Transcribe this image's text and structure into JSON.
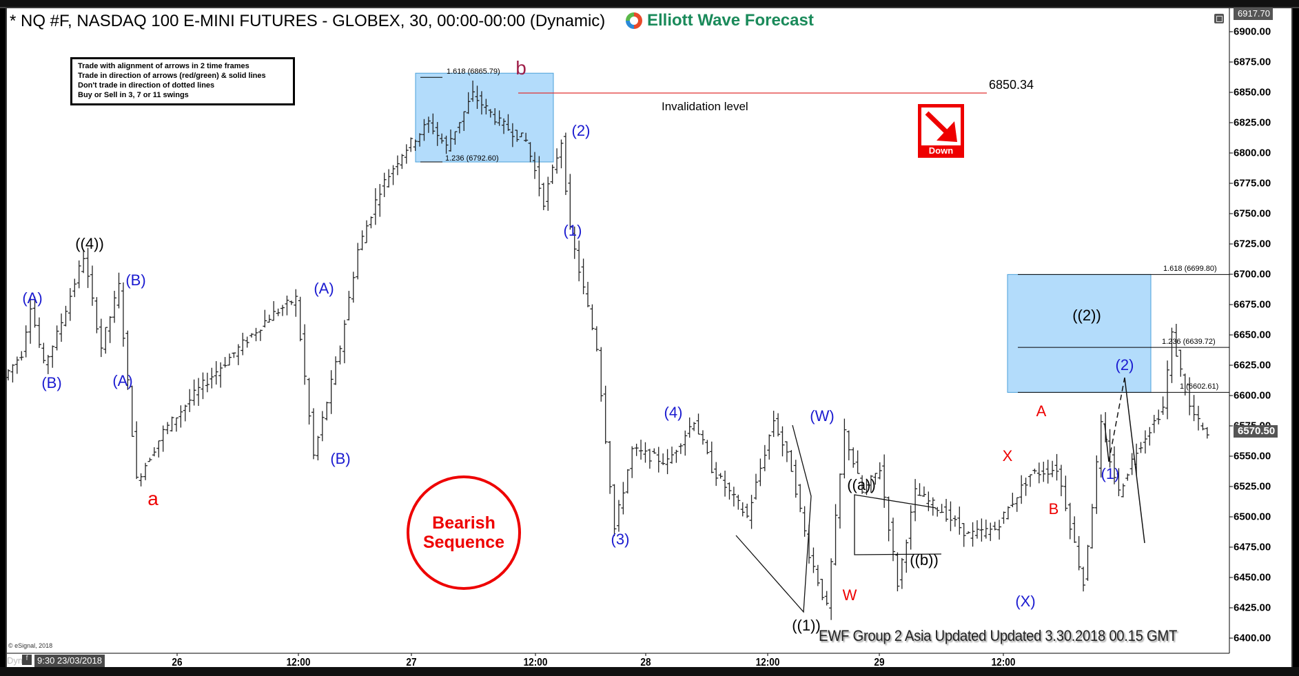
{
  "header": {
    "title": "* NQ #F, NASDAQ 100 E-MINI FUTURES - GLOBEX, 30, 00:00-00:00 (Dynamic)",
    "logo_text": "Elliott Wave Forecast"
  },
  "rules_box": [
    "Trade with alignment of arrows in 2 time frames",
    "Trade in direction of arrows (red/green) & solid lines",
    "Don't trade in direction of dotted lines",
    "Buy or Sell in 3, 7 or 11 swings"
  ],
  "badges": {
    "down_label": "Down",
    "bearish_line1": "Bearish",
    "bearish_line2": "Sequence"
  },
  "invalidation": {
    "value": "6850.34",
    "label": "Invalidation level",
    "color": "#e03030"
  },
  "footer": {
    "copyright": "© eSignal, 2018",
    "dyn": "Dyn",
    "start_date": "9:30 23/03/2018",
    "update_note": "EWF Group 2 Asia Updated Updated 3.30.2018 00.15 GMT"
  },
  "colors": {
    "fib_box": "#b3dcfb",
    "fib_border": "#4a9fd8",
    "wave_blue": "#1a1ad0",
    "wave_red": "#e00000",
    "wave_black": "#000000",
    "wave_b": "#a0204a"
  },
  "chart_data": {
    "type": "bar",
    "title": "NQ #F, NASDAQ 100 E-MINI FUTURES - GLOBEX, 30 min",
    "ylim": [
      6400,
      6917.7
    ],
    "yticks": [
      "6900.00",
      "6875.00",
      "6850.00",
      "6825.00",
      "6800.00",
      "6775.00",
      "6750.00",
      "6725.00",
      "6700.00",
      "6675.00",
      "6650.00",
      "6625.00",
      "6600.00",
      "6575.00",
      "6550.00",
      "6525.00",
      "6500.00",
      "6475.00",
      "6450.00",
      "6425.00",
      "6400.00"
    ],
    "xticks": [
      "26",
      "12:00",
      "27",
      "12:00",
      "28",
      "12:00",
      "29",
      "12:00"
    ],
    "top_price_tag": "6917.70",
    "last_price": "6570.50",
    "price_path_pivots": [
      [
        0,
        6615
      ],
      [
        4,
        6635
      ],
      [
        6,
        6675
      ],
      [
        9,
        6625
      ],
      [
        12,
        6650
      ],
      [
        18,
        6715
      ],
      [
        22,
        6640
      ],
      [
        26,
        6690
      ],
      [
        30,
        6530
      ],
      [
        36,
        6570
      ],
      [
        44,
        6605
      ],
      [
        60,
        6665
      ],
      [
        66,
        6680
      ],
      [
        70,
        6550
      ],
      [
        76,
        6640
      ],
      [
        80,
        6720
      ],
      [
        85,
        6770
      ],
      [
        90,
        6800
      ],
      [
        96,
        6825
      ],
      [
        100,
        6805
      ],
      [
        106,
        6848
      ],
      [
        112,
        6825
      ],
      [
        118,
        6810
      ],
      [
        122,
        6760
      ],
      [
        126,
        6810
      ],
      [
        128,
        6735
      ],
      [
        134,
        6640
      ],
      [
        138,
        6490
      ],
      [
        142,
        6555
      ],
      [
        150,
        6545
      ],
      [
        156,
        6580
      ],
      [
        160,
        6540
      ],
      [
        168,
        6500
      ],
      [
        174,
        6580
      ],
      [
        178,
        6540
      ],
      [
        182,
        6470
      ],
      [
        186,
        6425
      ],
      [
        190,
        6570
      ],
      [
        194,
        6520
      ],
      [
        198,
        6540
      ],
      [
        202,
        6445
      ],
      [
        206,
        6520
      ],
      [
        212,
        6505
      ],
      [
        218,
        6485
      ],
      [
        224,
        6490
      ],
      [
        232,
        6535
      ],
      [
        238,
        6540
      ],
      [
        240,
        6510
      ],
      [
        244,
        6445
      ],
      [
        248,
        6575
      ],
      [
        252,
        6520
      ],
      [
        256,
        6555
      ],
      [
        262,
        6590
      ],
      [
        264,
        6650
      ],
      [
        268,
        6590
      ],
      [
        272,
        6565
      ]
    ],
    "wave_labels": [
      {
        "text": "(A)",
        "price": 6680,
        "color": "blue"
      },
      {
        "text": "(B)",
        "price": 6610,
        "color": "blue"
      },
      {
        "text": "((4))",
        "price": 6725,
        "color": "black"
      },
      {
        "text": "(B)",
        "price": 6695,
        "color": "blue"
      },
      {
        "text": "(A)",
        "price": 6612,
        "color": "blue"
      },
      {
        "text": "a",
        "price": 6515,
        "color": "red"
      },
      {
        "text": "(A)",
        "price": 6688,
        "color": "blue"
      },
      {
        "text": "(B)",
        "price": 6548,
        "color": "blue"
      },
      {
        "text": "b",
        "price": 6870,
        "color": "maroon"
      },
      {
        "text": "(2)",
        "price": 6818,
        "color": "blue"
      },
      {
        "text": "(1)",
        "price": 6736,
        "color": "blue"
      },
      {
        "text": "(3)",
        "price": 6481,
        "color": "blue"
      },
      {
        "text": "(4)",
        "price": 6586,
        "color": "blue"
      },
      {
        "text": "(W)",
        "price": 6583,
        "color": "blue"
      },
      {
        "text": "((1))",
        "price": 6410,
        "color": "black"
      },
      {
        "text": "W",
        "price": 6435,
        "color": "red"
      },
      {
        "text": "((a))",
        "price": 6526,
        "color": "black"
      },
      {
        "text": "((b))",
        "price": 6464,
        "color": "black"
      },
      {
        "text": "X",
        "price": 6550,
        "color": "red"
      },
      {
        "text": "(X)",
        "price": 6430,
        "color": "blue"
      },
      {
        "text": "A",
        "price": 6587,
        "color": "red"
      },
      {
        "text": "B",
        "price": 6506,
        "color": "red"
      },
      {
        "text": "((2))",
        "price": 6666,
        "color": "black"
      },
      {
        "text": "(2)",
        "price": 6625,
        "color": "blue"
      },
      {
        "text": "(1)",
        "price": 6535,
        "color": "blue"
      }
    ],
    "fib_zones": [
      {
        "levels": [
          {
            "label": "1.618 (6865.79)",
            "price": 6865.79
          },
          {
            "label": "1.236 (6792.60)",
            "price": 6792.6
          }
        ]
      },
      {
        "levels": [
          {
            "label": "1.618 (6699.80)",
            "price": 6699.8
          },
          {
            "label": "1.236 (6639.72)",
            "price": 6639.72
          },
          {
            "label": "1 (6602.61)",
            "price": 6602.61
          }
        ]
      }
    ]
  }
}
